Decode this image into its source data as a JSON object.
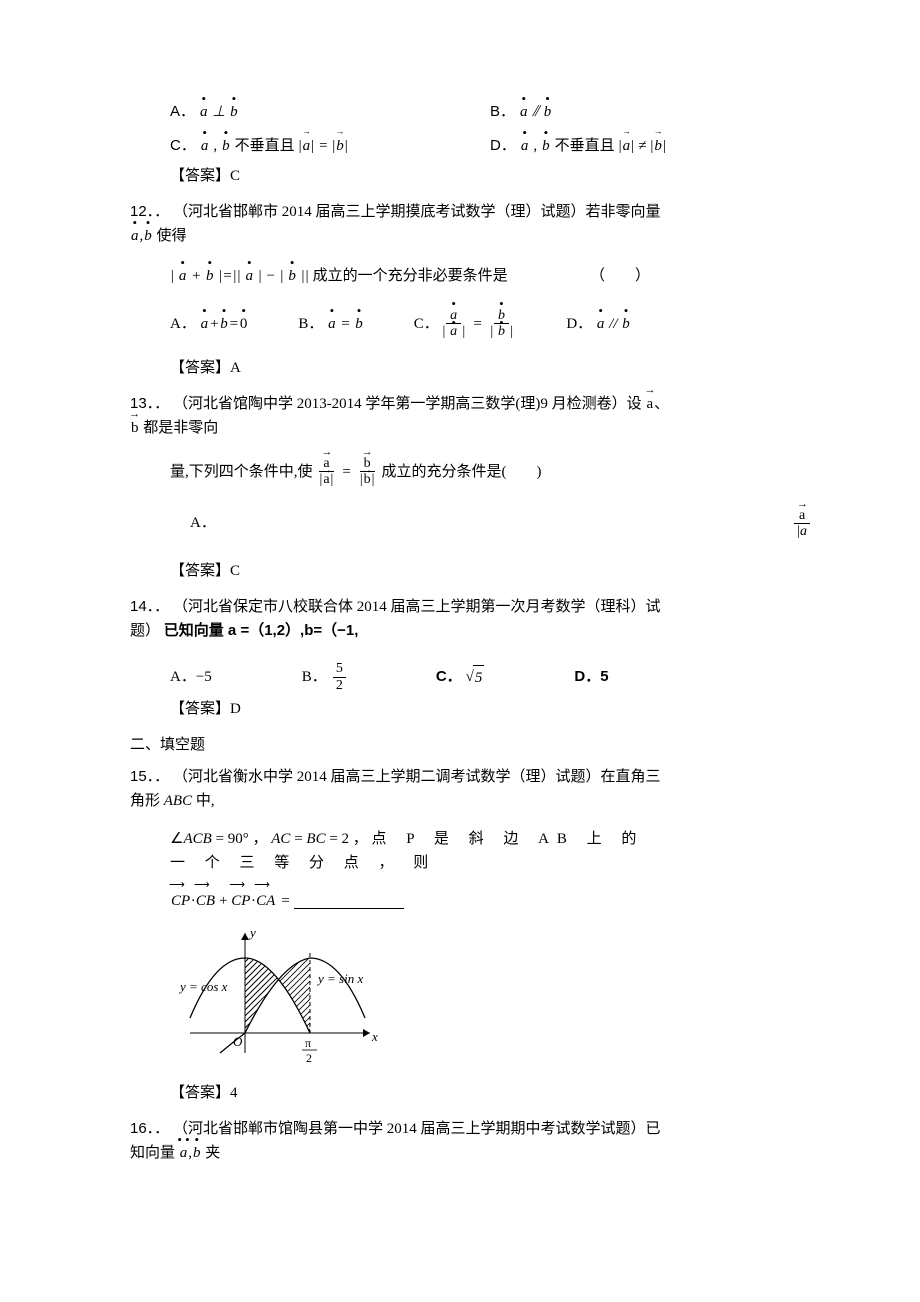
{
  "q11_options": {
    "A_pre": "A．",
    "B_pre": "B．",
    "C_pre": "C．",
    "D_pre": "D．",
    "C_text": "不垂直且",
    "D_text": "不垂直且",
    "perp": "⊥",
    "para": "⫽",
    "eq": "=",
    "neq": "≠"
  },
  "q11_ans": "【答案】C",
  "q12_num": "12．．",
  "q12_src": "（河北省邯郸市 2014 届高三上学期摸底考试数学（理）试题）若非零向量",
  "q12_src_tail": "使得",
  "q12_body": "成立的一个充分非必要条件是",
  "q12_paren": "（　　）",
  "q12_options": {
    "A": "A．",
    "B": "B．",
    "C": "C．",
    "D": "D．",
    "plus": "+",
    "eq": "=",
    "zero": "0",
    "para": "//"
  },
  "q12_ans": "【答案】A",
  "q13_num": "13．．",
  "q13_src": "（河北省馆陶中学 2013-2014 学年第一学期高三数学(理)9 月检测卷）设",
  "q13_src_tail": "都是非零向",
  "q13_body_1": "量,下列四个条件中,使",
  "q13_body_2": "成立的充分条件是(　　)",
  "q13_optA": "A．",
  "q13_ans": "【答案】C",
  "q14_num": "14．．",
  "q14_src": "（河北省保定市八校联合体 2014 届高三上学期第一次月考数学（理科）试题）",
  "q14_bold": "已知向量 a =（1,2）,b=（−1,",
  "q14_options": {
    "A": "A．−5",
    "B": "B．",
    "Bval_num": "5",
    "Bval_den": "2",
    "C": "C．",
    "D": "D．5"
  },
  "q14_ans": "【答案】D",
  "section2": "二、填空题",
  "q15_num": "15．．",
  "q15_src": "（河北省衡水中学 2014 届高三上学期二调考试数学（理）试题）在直角三角形",
  "q15_src_ital": "ABC",
  "q15_src_tail": " 中,",
  "q15_l1_a": "∠",
  "q15_l1_b": "ACB",
  "q15_l1_c": " = 90° ，",
  "q15_l1_d": "AC",
  "q15_l1_e": " = ",
  "q15_l1_f": "BC",
  "q15_l1_g": " = 2 ，",
  "q15_l1_rest": "点  P 是 斜 边  AB 上 的 一 个 三 等 分 点 ， 则",
  "q15_expr_parts": {
    "cp": "CP",
    "cb": "CB",
    "ca": "CA",
    "dot": "·",
    "plus": "+",
    "eq": "="
  },
  "q15_ans": "【答案】4",
  "q16_num": "16．．",
  "q16_src": "（河北省邯郸市馆陶县第一中学 2014 届高三上学期期中考试数学试题）已知向量",
  "q16_tail": " 夹",
  "fig_labels": {
    "y": "y",
    "x": "x",
    "O": "O",
    "cos": "y = cos x",
    "sin": "y = sin x",
    "pi2_num": "π",
    "pi2_den": "2"
  }
}
